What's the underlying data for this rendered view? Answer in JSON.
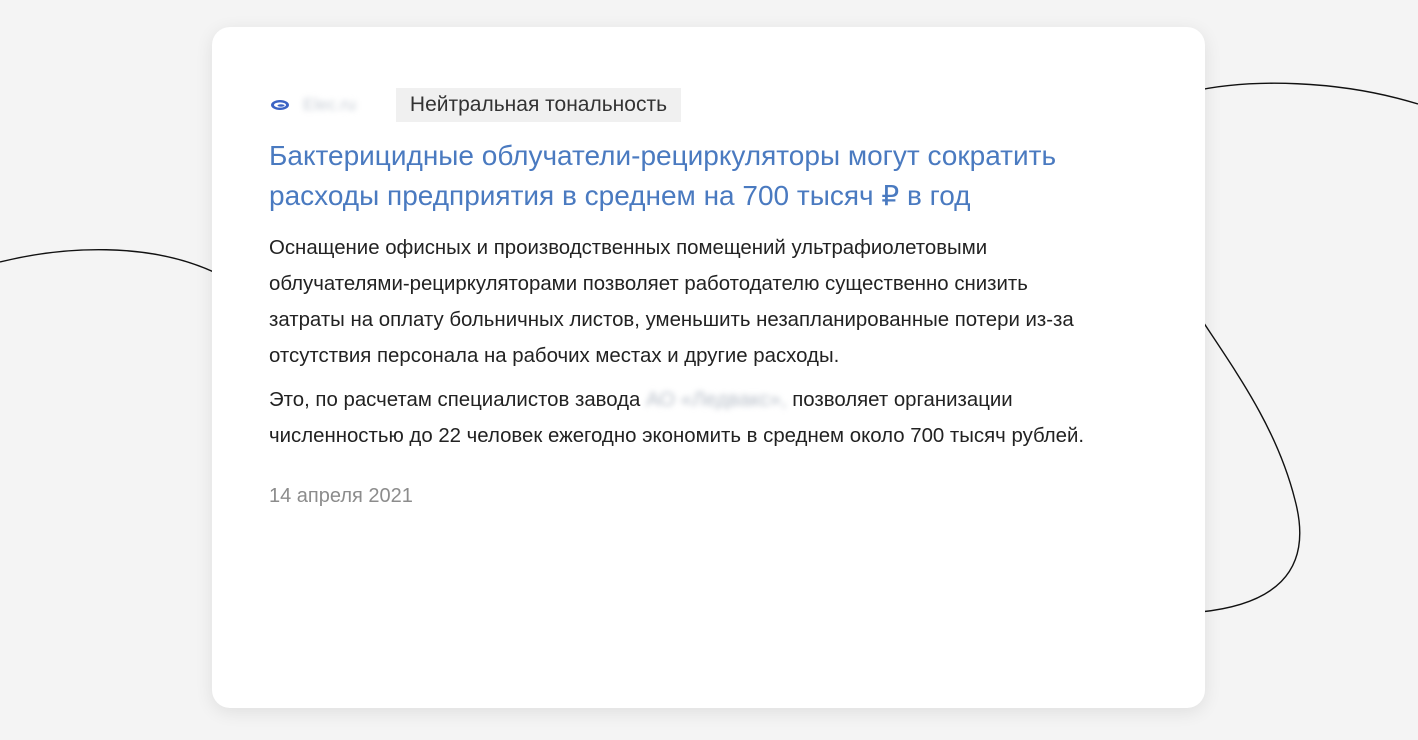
{
  "source": {
    "logo_icon": "source-logo-icon",
    "name": "Elec.ru"
  },
  "tone_badge": "Нейтральная тональность",
  "headline": "Бактерицидные облучатели-рециркуляторы могут сократить расходы предприятия в среднем на 700 тысяч ₽ в год",
  "body": {
    "paragraph1": "Оснащение офисных и производственных помещений ультрафиолетовыми облучателями-рециркуляторами позволяет работодателю существенно снизить затраты на оплату больничных листов, уменьшить незапланированные потери из-за отсутствия персонала на рабочих местах и другие расходы.",
    "paragraph2_before": "Это, по расчетам специалистов завода",
    "paragraph2_redacted": "АО «Ледвакс»,",
    "paragraph2_after": "позволяет организации численностью до 22 человек ежегодно экономить в среднем около 700 тысяч рублей."
  },
  "date": "14 апреля 2021",
  "colors": {
    "background": "#f4f4f4",
    "card": "#ffffff",
    "headline_link": "#4a7ac0",
    "body_text": "#222222",
    "date_text": "#8c8c8c",
    "badge_bg": "#f0f0f0",
    "decorative_line": "#111111"
  }
}
